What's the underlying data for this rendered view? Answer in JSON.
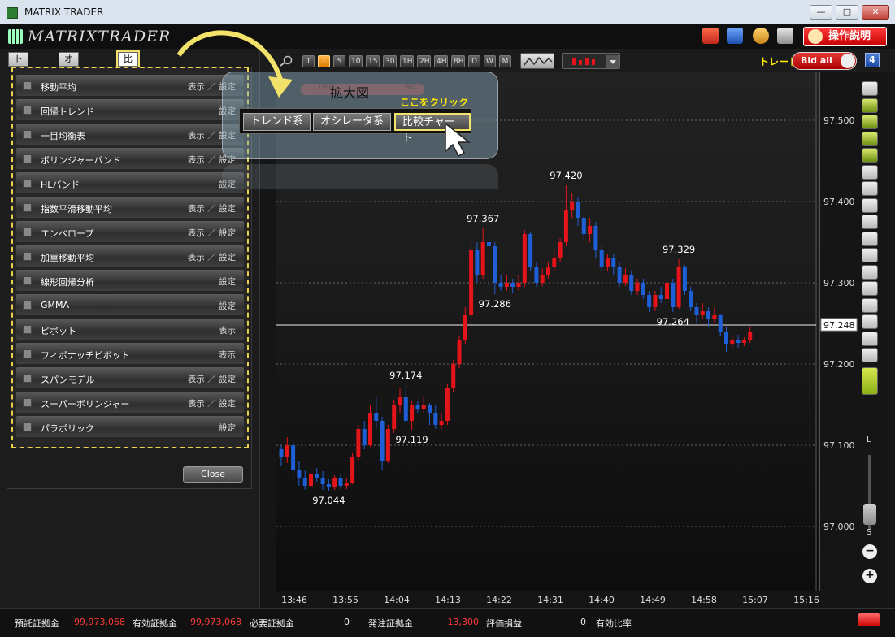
{
  "window": {
    "title": "MATRIX TRADER",
    "logo_text": "MATRIXTRADER",
    "help_label": "操作説明"
  },
  "left_tabs": [
    {
      "label": "トレンド系"
    },
    {
      "label": "オシレータ系"
    },
    {
      "label": "比較チャート"
    }
  ],
  "indicators": [
    {
      "label": "移動平均",
      "action": "表示 ／ 設定"
    },
    {
      "label": "回帰トレンド",
      "action": "設定"
    },
    {
      "label": "一目均衡表",
      "action": "表示 ／ 設定"
    },
    {
      "label": "ボリンジャーバンド",
      "action": "表示 ／ 設定"
    },
    {
      "label": "HLバンド",
      "action": "設定"
    },
    {
      "label": "指数平滑移動平均",
      "action": "表示 ／ 設定"
    },
    {
      "label": "エンベロープ",
      "action": "表示 ／ 設定"
    },
    {
      "label": "加重移動平均",
      "action": "表示 ／ 設定"
    },
    {
      "label": "線形回帰分析",
      "action": "設定"
    },
    {
      "label": "GMMA",
      "action": "設定"
    },
    {
      "label": "ピボット",
      "action": "表示"
    },
    {
      "label": "フィボナッチピボット",
      "action": "表示"
    },
    {
      "label": "スパンモデル",
      "action": "表示 ／ 設定"
    },
    {
      "label": "スーパーボリンジャー",
      "action": "表示 ／ 設定"
    },
    {
      "label": "パラボリック",
      "action": "設定"
    }
  ],
  "close_label": "Close",
  "timeframes": [
    "T",
    "1",
    "5",
    "10",
    "15",
    "30",
    "1H",
    "2H",
    "4H",
    "8H",
    "D",
    "W",
    "M"
  ],
  "active_timeframe": "1",
  "trade": {
    "label": "トレード",
    "toggle_label": "Bid all",
    "badge": "4"
  },
  "callout": {
    "title": "拡大図",
    "hint": "ここをクリック",
    "ghost_left": "USD",
    "ghost_right": "Bid",
    "tabs": [
      "トレンド系",
      "オシレータ系",
      "比較チャート"
    ]
  },
  "zoom": {
    "large": "L",
    "small": "S",
    "plus": "+",
    "minus": "−"
  },
  "colors": {
    "up": "#e4141a",
    "down": "#1f5fd6",
    "accent": "#f3e26a",
    "trade_red": "#d61b1b"
  },
  "status": [
    {
      "label": "預託証拠金",
      "value": "99,973,068",
      "color": "red"
    },
    {
      "label": "有効証拠金",
      "value": "99,973,068",
      "color": "red"
    },
    {
      "label": "必要証拠金",
      "value": "0",
      "color": "white"
    },
    {
      "label": "発注証拠金",
      "value": "13,300",
      "color": "red"
    },
    {
      "label": "評価損益",
      "value": "0",
      "color": "white"
    },
    {
      "label": "有効比率",
      "value": "",
      "color": "white"
    }
  ],
  "chart_data": {
    "type": "candlestick",
    "ylim": [
      96.92,
      97.56
    ],
    "yticks": [
      "97.500",
      "97.400",
      "97.300",
      "97.200",
      "97.100",
      "97.000"
    ],
    "xticks": [
      "13:46",
      "13:55",
      "14:04",
      "14:13",
      "14:22",
      "14:31",
      "14:40",
      "14:49",
      "14:58",
      "15:07",
      "15:16"
    ],
    "current_price": "97.248",
    "annotations": [
      {
        "label": "97.044",
        "value": 97.044,
        "index": 8
      },
      {
        "label": "97.174",
        "value": 97.174,
        "index": 21
      },
      {
        "label": "97.119",
        "value": 97.119,
        "index": 22
      },
      {
        "label": "97.367",
        "value": 97.367,
        "index": 34
      },
      {
        "label": "97.286",
        "value": 97.286,
        "index": 36
      },
      {
        "label": "97.420",
        "value": 97.42,
        "index": 48
      },
      {
        "label": "97.329",
        "value": 97.329,
        "index": 67
      },
      {
        "label": "97.264",
        "value": 97.264,
        "index": 66
      }
    ],
    "candles": [
      [
        97.095,
        97.085,
        97.1,
        97.075
      ],
      [
        97.085,
        97.1,
        97.11,
        97.078
      ],
      [
        97.1,
        97.07,
        97.105,
        97.06
      ],
      [
        97.07,
        97.06,
        97.08,
        97.05
      ],
      [
        97.06,
        97.05,
        97.07,
        97.045
      ],
      [
        97.05,
        97.065,
        97.072,
        97.046
      ],
      [
        97.065,
        97.06,
        97.072,
        97.055
      ],
      [
        97.06,
        97.052,
        97.068,
        97.045
      ],
      [
        97.052,
        97.048,
        97.058,
        97.044
      ],
      [
        97.048,
        97.06,
        97.063,
        97.045
      ],
      [
        97.06,
        97.05,
        97.065,
        97.046
      ],
      [
        97.05,
        97.054,
        97.06,
        97.046
      ],
      [
        97.054,
        97.085,
        97.09,
        97.052
      ],
      [
        97.085,
        97.12,
        97.125,
        97.08
      ],
      [
        97.12,
        97.1,
        97.13,
        97.095
      ],
      [
        97.1,
        97.14,
        97.15,
        97.098
      ],
      [
        97.14,
        97.13,
        97.16,
        97.12
      ],
      [
        97.13,
        97.08,
        97.135,
        97.07
      ],
      [
        97.08,
        97.12,
        97.125,
        97.078
      ],
      [
        97.12,
        97.15,
        97.156,
        97.115
      ],
      [
        97.15,
        97.16,
        97.17,
        97.14
      ],
      [
        97.16,
        97.13,
        97.174,
        97.125
      ],
      [
        97.13,
        97.15,
        97.155,
        97.119
      ],
      [
        97.15,
        97.145,
        97.155,
        97.14
      ],
      [
        97.145,
        97.15,
        97.16,
        97.14
      ],
      [
        97.15,
        97.14,
        97.152,
        97.125
      ],
      [
        97.14,
        97.125,
        97.15,
        97.12
      ],
      [
        97.125,
        97.13,
        97.14,
        97.12
      ],
      [
        97.13,
        97.17,
        97.175,
        97.125
      ],
      [
        97.17,
        97.2,
        97.205,
        97.165
      ],
      [
        97.2,
        97.23,
        97.235,
        97.195
      ],
      [
        97.23,
        97.26,
        97.27,
        97.225
      ],
      [
        97.26,
        97.34,
        97.35,
        97.255
      ],
      [
        97.34,
        97.31,
        97.35,
        97.3
      ],
      [
        97.31,
        97.35,
        97.367,
        97.305
      ],
      [
        97.35,
        97.345,
        97.36,
        97.33
      ],
      [
        97.345,
        97.3,
        97.35,
        97.286
      ],
      [
        97.3,
        97.295,
        97.31,
        97.29
      ],
      [
        97.295,
        97.3,
        97.31,
        97.29
      ],
      [
        97.3,
        97.295,
        97.305,
        97.288
      ],
      [
        97.295,
        97.3,
        97.31,
        97.29
      ],
      [
        97.3,
        97.36,
        97.365,
        97.295
      ],
      [
        97.36,
        97.32,
        97.362,
        97.315
      ],
      [
        97.32,
        97.3,
        97.325,
        97.295
      ],
      [
        97.3,
        97.31,
        97.318,
        97.296
      ],
      [
        97.31,
        97.32,
        97.325,
        97.305
      ],
      [
        97.32,
        97.33,
        97.34,
        97.315
      ],
      [
        97.33,
        97.35,
        97.355,
        97.325
      ],
      [
        97.35,
        97.39,
        97.42,
        97.345
      ],
      [
        97.39,
        97.4,
        97.41,
        97.38
      ],
      [
        97.4,
        97.38,
        97.405,
        97.37
      ],
      [
        97.38,
        97.36,
        97.385,
        97.35
      ],
      [
        97.36,
        97.37,
        97.38,
        97.35
      ],
      [
        97.37,
        97.34,
        97.375,
        97.33
      ],
      [
        97.34,
        97.32,
        97.345,
        97.315
      ],
      [
        97.32,
        97.33,
        97.335,
        97.315
      ],
      [
        97.33,
        97.32,
        97.335,
        97.31
      ],
      [
        97.32,
        97.3,
        97.325,
        97.295
      ],
      [
        97.3,
        97.31,
        97.318,
        97.296
      ],
      [
        97.31,
        97.29,
        97.315,
        97.285
      ],
      [
        97.29,
        97.3,
        97.305,
        97.285
      ],
      [
        97.3,
        97.285,
        97.305,
        97.28
      ],
      [
        97.285,
        97.27,
        97.29,
        97.264
      ],
      [
        97.27,
        97.285,
        97.29,
        97.265
      ],
      [
        97.285,
        97.28,
        97.295,
        97.275
      ],
      [
        97.28,
        97.3,
        97.31,
        97.278
      ],
      [
        97.3,
        97.27,
        97.305,
        97.264
      ],
      [
        97.27,
        97.32,
        97.329,
        97.268
      ],
      [
        97.32,
        97.29,
        97.322,
        97.285
      ],
      [
        97.29,
        97.27,
        97.295,
        97.265
      ],
      [
        97.27,
        97.26,
        97.275,
        97.25
      ],
      [
        97.26,
        97.265,
        97.275,
        97.255
      ],
      [
        97.265,
        97.255,
        97.27,
        97.245
      ],
      [
        97.255,
        97.26,
        97.27,
        97.25
      ],
      [
        97.26,
        97.24,
        97.262,
        97.235
      ],
      [
        97.24,
        97.225,
        97.245,
        97.215
      ],
      [
        97.225,
        97.23,
        97.235,
        97.218
      ],
      [
        97.23,
        97.226,
        97.236,
        97.22
      ],
      [
        97.226,
        97.229,
        97.233,
        97.222
      ],
      [
        97.229,
        97.24,
        97.245,
        97.226
      ]
    ]
  }
}
